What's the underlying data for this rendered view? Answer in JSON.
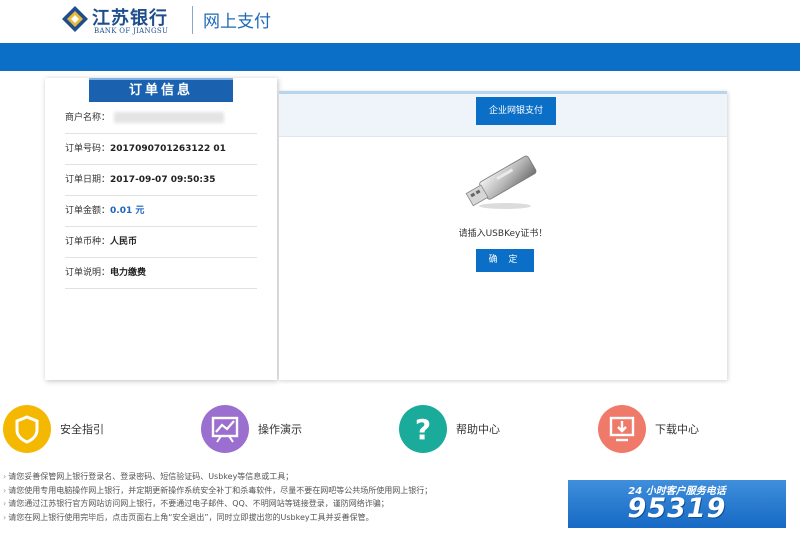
{
  "header": {
    "logo_cn": "江苏银行",
    "logo_en": "BANK OF JIANGSU",
    "title": "网上支付"
  },
  "order": {
    "tab_title": "订单信息",
    "rows": [
      {
        "label": "商户名称：",
        "value": ""
      },
      {
        "label": "订单号码：",
        "value": "2017090701263122 01"
      },
      {
        "label": "订单日期：",
        "value": "2017-09-07 09:50:35"
      },
      {
        "label": "订单金额：",
        "value": "0.01 元"
      },
      {
        "label": "订单币种：",
        "value": "人民币"
      },
      {
        "label": "订单说明：",
        "value": "电力缴费"
      }
    ]
  },
  "payment": {
    "tab_label": "企业网银支付",
    "message": "请插入USBKey证书！",
    "confirm_label": "确 定",
    "device_icon": "usb-key-icon"
  },
  "services": [
    {
      "label": "安全指引",
      "icon": "shield-icon",
      "color": "#f5b800"
    },
    {
      "label": "操作演示",
      "icon": "presentation-chart-icon",
      "color": "#9b6fd0"
    },
    {
      "label": "帮助中心",
      "icon": "question-icon",
      "color": "#1aab9b"
    },
    {
      "label": "下载中心",
      "icon": "download-monitor-icon",
      "color": "#f07a6a"
    }
  ],
  "notices": [
    "请您妥善保管网上银行登录名、登录密码、短信验证码、Usbkey等信息或工具；",
    "请您使用专用电脑操作网上银行，并定期更新操作系统安全补丁和杀毒软件，尽量不要在网吧等公共场所使用网上银行；",
    "请您通过江苏银行官方网站访问网上银行，不要通过电子邮件、QQ、不明网站等链接登录，谨防网络诈骗；",
    "请您在网上银行使用完毕后，点击页面右上角“安全退出”，同时立即拔出您的Usbkey工具并妥善保管。"
  ],
  "hotline": {
    "label": "24 小时客户服务电话",
    "number": "95319"
  },
  "colors": {
    "brand_blue": "#0b6fc7",
    "tab_blue": "#1a62b0",
    "amount_blue": "#1b64c0"
  }
}
